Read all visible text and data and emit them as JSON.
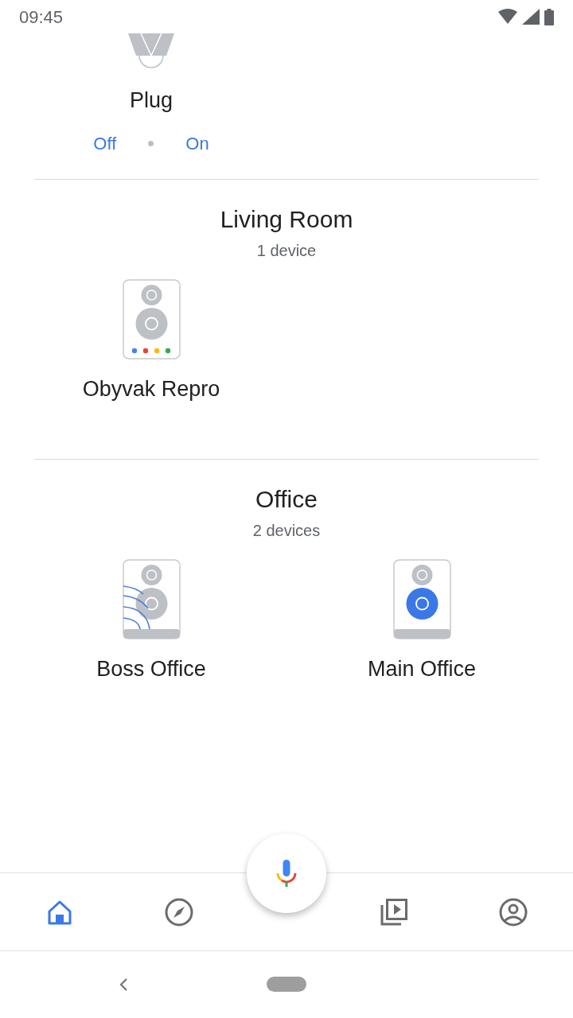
{
  "status_bar": {
    "time": "09:45"
  },
  "sections": [
    {
      "devices": [
        {
          "name": "Plug",
          "kind": "plug",
          "actions": [
            "Off",
            "On"
          ]
        }
      ]
    },
    {
      "title": "Living Room",
      "count": "1 device",
      "devices": [
        {
          "name": "Obyvak Repro",
          "kind": "assistant"
        }
      ]
    },
    {
      "title": "Office",
      "count": "2 devices",
      "devices": [
        {
          "name": "Boss Office",
          "kind": "casting"
        },
        {
          "name": "Main Office",
          "kind": "playing"
        }
      ]
    }
  ],
  "bottom_nav": [
    {
      "kind": "home",
      "selected": true
    },
    {
      "kind": "discover",
      "selected": false
    },
    {
      "kind": "media",
      "selected": false
    },
    {
      "kind": "account",
      "selected": false
    }
  ]
}
